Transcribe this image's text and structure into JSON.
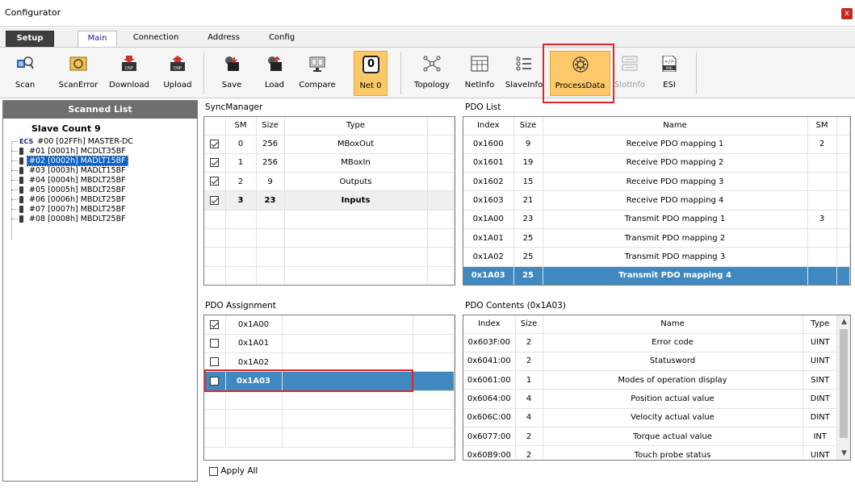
{
  "window": {
    "title": "Configurator",
    "close": "x"
  },
  "tabs": [
    "Setup",
    "Main",
    "Connection",
    "Address",
    "Config"
  ],
  "ribbon": [
    {
      "label": "Scan",
      "icon": "scan-icon"
    },
    {
      "label": "ScanError",
      "icon": "scan-error-icon"
    },
    {
      "label": "Download",
      "icon": "download-icon"
    },
    {
      "label": "Upload",
      "icon": "upload-icon"
    },
    {
      "label": "Save",
      "icon": "save-icon"
    },
    {
      "label": "Load",
      "icon": "load-icon"
    },
    {
      "label": "Compare",
      "icon": "compare-icon"
    },
    {
      "label": "Net 0",
      "icon": "net-icon",
      "value": "0"
    },
    {
      "label": "Topology",
      "icon": "topology-icon"
    },
    {
      "label": "NetInfo",
      "icon": "netinfo-icon"
    },
    {
      "label": "SlaveInfo",
      "icon": "slaveinfo-icon"
    },
    {
      "label": "ProcessData",
      "icon": "processdata-icon"
    },
    {
      "label": "SlotInfo",
      "icon": "slotinfo-icon"
    },
    {
      "label": "ESI",
      "icon": "esi-icon",
      "icon_text": "XML"
    }
  ],
  "scanned": {
    "header": "Scanned List",
    "slave_count": "Slave Count  9",
    "items": [
      {
        "text": "#00  [02FFh] MASTER-DC",
        "badge": "ECS"
      },
      {
        "text": "#01  [0001h] MCDLT35BF"
      },
      {
        "text": "#02  [0002h] MADLT15BF",
        "selected": true
      },
      {
        "text": "#03  [0003h] MADLT15BF"
      },
      {
        "text": "#04  [0004h] MBDLT25BF"
      },
      {
        "text": "#05  [0005h] MBDLT25BF"
      },
      {
        "text": "#06  [0006h] MBDLT25BF"
      },
      {
        "text": "#07  [0007h] MBDLT25BF"
      },
      {
        "text": "#08  [0008h] MBDLT25BF"
      }
    ]
  },
  "sync": {
    "label": "SyncManager",
    "headers": [
      "",
      "SM",
      "Size",
      "Type"
    ],
    "rows": [
      {
        "checked": true,
        "sm": "0",
        "size": "256",
        "type": "MBoxOut"
      },
      {
        "checked": true,
        "sm": "1",
        "size": "256",
        "type": "MBoxIn"
      },
      {
        "checked": true,
        "sm": "2",
        "size": "9",
        "type": "Outputs"
      },
      {
        "checked": true,
        "sm": "3",
        "size": "23",
        "type": "Inputs",
        "bold": true
      }
    ]
  },
  "pdolist": {
    "label": "PDO List",
    "headers": [
      "Index",
      "Size",
      "Name",
      "SM"
    ],
    "rows": [
      {
        "index": "0x1600",
        "size": "9",
        "name": "Receive PDO mapping 1",
        "sm": "2"
      },
      {
        "index": "0x1601",
        "size": "19",
        "name": "Receive PDO mapping 2",
        "sm": ""
      },
      {
        "index": "0x1602",
        "size": "15",
        "name": "Receive PDO mapping 3",
        "sm": ""
      },
      {
        "index": "0x1603",
        "size": "21",
        "name": "Receive PDO mapping 4",
        "sm": ""
      },
      {
        "index": "0x1A00",
        "size": "23",
        "name": "Transmit PDO mapping 1",
        "sm": "3"
      },
      {
        "index": "0x1A01",
        "size": "25",
        "name": "Transmit PDO mapping 2",
        "sm": ""
      },
      {
        "index": "0x1A02",
        "size": "25",
        "name": "Transmit PDO mapping 3",
        "sm": ""
      },
      {
        "index": "0x1A03",
        "size": "25",
        "name": "Transmit PDO mapping 4",
        "sm": "",
        "selected": true
      }
    ]
  },
  "assign": {
    "label": "PDO Assignment",
    "rows": [
      {
        "checked": true,
        "index": "0x1A00"
      },
      {
        "checked": false,
        "index": "0x1A01"
      },
      {
        "checked": false,
        "index": "0x1A02"
      },
      {
        "checked": false,
        "index": "0x1A03",
        "selected": true
      }
    ],
    "apply_all": "Apply All"
  },
  "contents": {
    "label": "PDO Contents (0x1A03)",
    "headers": [
      "Index",
      "Size",
      "Name",
      "Type"
    ],
    "rows": [
      {
        "index": "0x603F:00",
        "size": "2",
        "name": "Error code",
        "type": "UINT"
      },
      {
        "index": "0x6041:00",
        "size": "2",
        "name": "Statusword",
        "type": "UINT"
      },
      {
        "index": "0x6061:00",
        "size": "1",
        "name": "Modes of operation display",
        "type": "SINT"
      },
      {
        "index": "0x6064:00",
        "size": "4",
        "name": "Position actual value",
        "type": "DINT"
      },
      {
        "index": "0x606C:00",
        "size": "4",
        "name": "Velocity actual value",
        "type": "DINT"
      },
      {
        "index": "0x6077:00",
        "size": "2",
        "name": "Torque actual value",
        "type": "INT"
      },
      {
        "index": "0x60B9:00",
        "size": "2",
        "name": "Touch probe status",
        "type": "UINT"
      }
    ]
  },
  "colors": {
    "accent": "#3f88c0",
    "selection": "#0a64c8",
    "highlight": "#e0262d",
    "active_button": "#fcc86a"
  }
}
